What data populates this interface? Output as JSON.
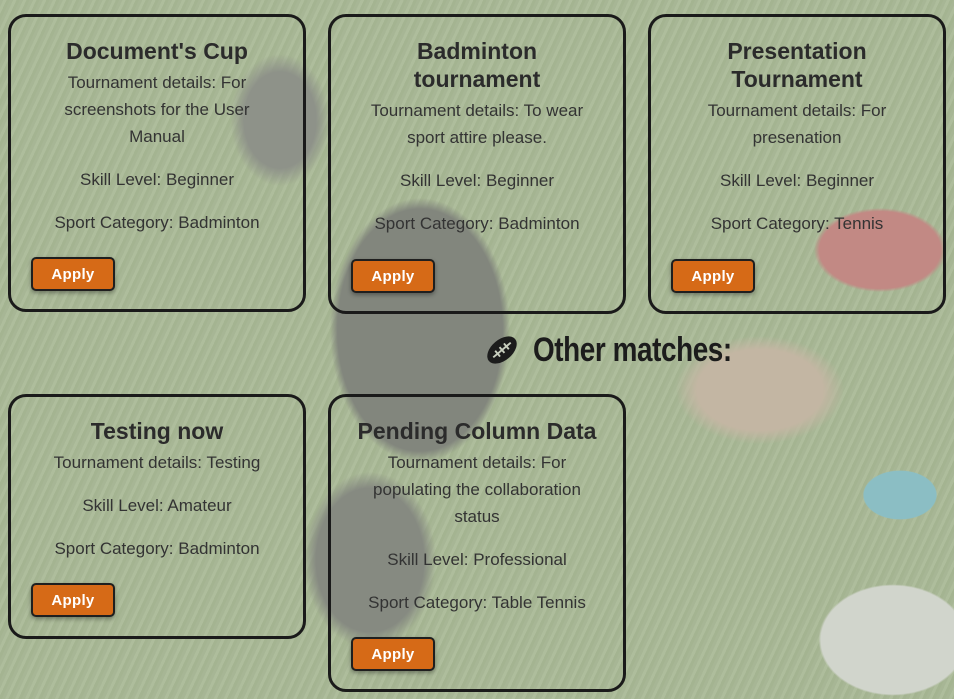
{
  "tournaments": [
    {
      "title": "Document's Cup",
      "details": "Tournament details: For screenshots for the User Manual",
      "skill": "Skill Level: Beginner",
      "category": "Sport Category: Badminton",
      "apply_label": "Apply"
    },
    {
      "title": "Badminton tournament",
      "details": "Tournament details: To wear sport attire please.",
      "skill": "Skill Level: Beginner",
      "category": "Sport Category: Badminton",
      "apply_label": "Apply"
    },
    {
      "title": "Presentation Tournament",
      "details": "Tournament details: For presenation",
      "skill": "Skill Level: Beginner",
      "category": "Sport Category: Tennis",
      "apply_label": "Apply"
    }
  ],
  "other_section": {
    "title": "Other matches:",
    "icon": "football-icon"
  },
  "other_matches": [
    {
      "title": "Testing now",
      "details": "Tournament details: Testing",
      "skill": "Skill Level: Amateur",
      "category": "Sport Category: Badminton",
      "apply_label": "Apply"
    },
    {
      "title": "Pending Column Data",
      "details": "Tournament details: For populating the collaboration status",
      "skill": "Skill Level: Professional",
      "category": "Sport Category: Table Tennis",
      "apply_label": "Apply"
    }
  ]
}
